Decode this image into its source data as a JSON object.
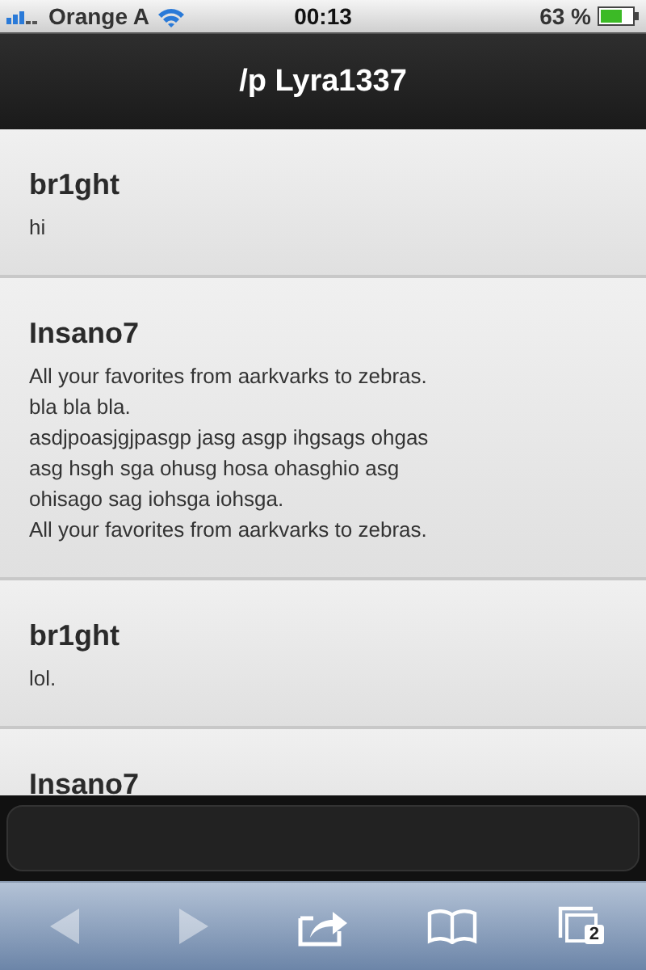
{
  "status_bar": {
    "carrier": "Orange A",
    "time": "00:13",
    "battery": "63 %"
  },
  "title": "/p Lyra1337",
  "messages": [
    {
      "author": "br1ght",
      "lines": [
        "hi"
      ]
    },
    {
      "author": "Insano7",
      "lines": [
        "All your favorites from aarkvarks to zebras.",
        "bla bla bla.",
        "asdjpoasjgjpasgp jasg asgp ihgsags ohgas",
        "asg hsgh sga ohusg hosa ohasghio asg",
        "ohisago sag iohsga iohsga.",
        "All your favorites from aarkvarks to zebras."
      ]
    },
    {
      "author": "br1ght",
      "lines": [
        "lol."
      ]
    },
    {
      "author": "Insano7"
    }
  ],
  "toolbar": [
    {
      "kind": "back",
      "disabled": true
    },
    {
      "kind": "forward",
      "disabled": true
    },
    {
      "kind": "share",
      "disabled": false
    },
    {
      "kind": "bookmarks",
      "disabled": false
    },
    {
      "kind": "tabs",
      "disabled": false,
      "count": "2"
    }
  ]
}
